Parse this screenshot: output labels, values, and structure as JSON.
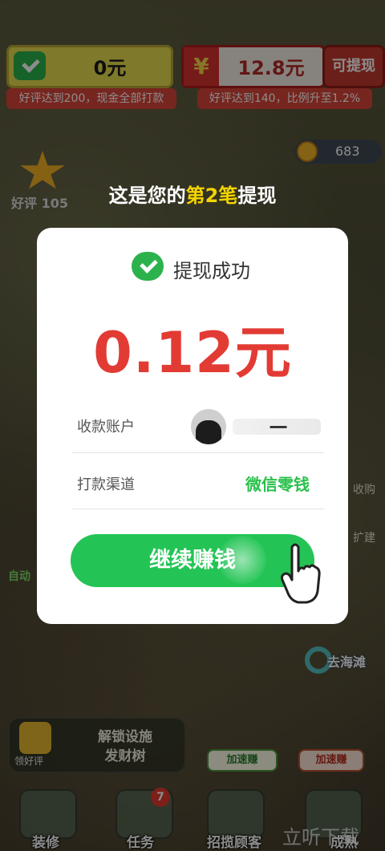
{
  "top": {
    "cash_value": "0元",
    "cash_hint": "好评达到200，现金全部打款",
    "balance_value": "12.8元",
    "balance_hint": "好评达到140，比例升至1.2%",
    "withdraw_label": "可提现",
    "coins": "683",
    "yuan_symbol": "¥"
  },
  "rating": {
    "label": "好评 105"
  },
  "headline": {
    "pre": "这是您的",
    "highlight": "第2笔",
    "post": "提现"
  },
  "modal": {
    "title": "提现成功",
    "amount": "0.12元",
    "account_label": "收款账户",
    "account_name": "一",
    "channel_label": "打款渠道",
    "channel_value": "微信零钱",
    "cta_label": "继续赚钱"
  },
  "scene": {
    "auto_label": "自动",
    "side_buy": "收购",
    "side_expand": "扩建",
    "beach_label": "去海滩"
  },
  "dock": {
    "unlock_line1": "解锁设施",
    "unlock_line2": "发财树",
    "get_review": "领好评",
    "speed_earn": "加速赚",
    "speed_earn_yuan": "加速赚",
    "task_badge": "7",
    "nav": [
      "装修",
      "任务",
      "招揽顾客",
      "成熟"
    ]
  },
  "watermark": "立听下载",
  "colors": {
    "wechat_green": "#2bb24c",
    "amount_red": "#e23b34",
    "cta_green": "#23c455",
    "headline_yellow": "#f4d400"
  }
}
